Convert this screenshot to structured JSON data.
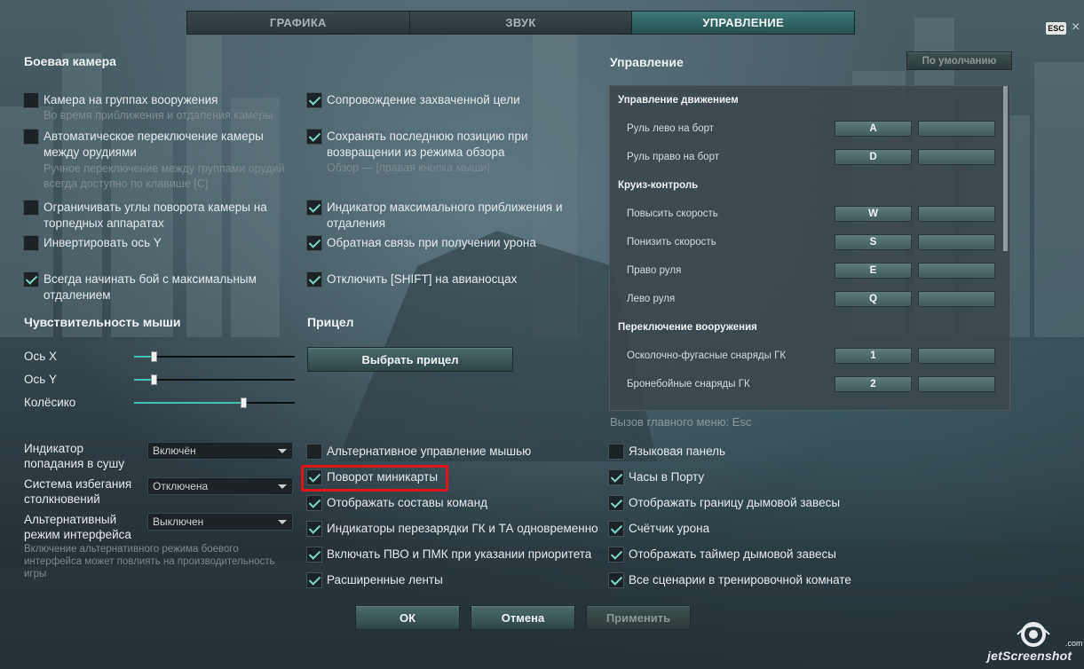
{
  "tabs": [
    {
      "label": "ГРАФИКА",
      "active": false
    },
    {
      "label": "ЗВУК",
      "active": false
    },
    {
      "label": "УПРАВЛЕНИЕ",
      "active": true
    }
  ],
  "esc_badge": "ESC",
  "close_glyph": "×",
  "camera": {
    "title": "Боевая камера",
    "left": [
      {
        "label": "Камера на группах вооружения",
        "sub": "Во время приближения и отдаления камеры",
        "checked": false
      },
      {
        "label": "Автоматическое переключение камеры между орудиями",
        "sub": "Ручное переключение между группами орудий всегда доступно по клавише [C]",
        "checked": false
      },
      {
        "label": "Ограничивать углы поворота камеры на торпедных аппаратах",
        "checked": false
      },
      {
        "label": "Инвертировать ось Y",
        "checked": false
      },
      {
        "label": "Всегда начинать бой с максимальным отдалением",
        "checked": true
      }
    ],
    "right": [
      {
        "label": "Сопровождение захваченной цели",
        "checked": true
      },
      {
        "label": "Сохранять последнюю позицию при возвращении из режима обзора",
        "sub": "Обзор — [правая кнопка мыши]",
        "checked": true
      },
      {
        "label": "Индикатор максимального приближения и отдаления",
        "checked": true
      },
      {
        "label": "Обратная связь при получении урона",
        "checked": true
      },
      {
        "label": "Отключить [SHIFT] на авианосцах",
        "checked": true
      }
    ]
  },
  "mouse": {
    "title": "Чувствительность мыши",
    "sliders": [
      {
        "label": "Ось X",
        "level": 0.12
      },
      {
        "label": "Ось Y",
        "level": 0.12
      },
      {
        "label": "Колёсико",
        "level": 0.68
      }
    ]
  },
  "sight": {
    "title": "Прицел",
    "button": "Выбрать прицел"
  },
  "dropdowns": [
    {
      "label": "Индикатор попадания в сушу",
      "value": "Включён"
    },
    {
      "label": "Система избегания столкновений",
      "value": "Отключена"
    },
    {
      "label": "Альтернативный режим интерфейса",
      "value": "Выключен"
    }
  ],
  "interface_note": "Включение альтернативного режима боевого интерфейса может повлиять на производительность игры",
  "middle_checks": [
    {
      "label": "Альтернативное управление мышью",
      "checked": false
    },
    {
      "label": "Поворот миникарты",
      "checked": true
    },
    {
      "label": "Отображать составы команд",
      "checked": true
    },
    {
      "label": "Индикаторы перезарядки ГК и ТА одновременно",
      "checked": true
    },
    {
      "label": "Включать ПВО и ПМК при указании приоритета",
      "checked": true
    },
    {
      "label": "Расширенные ленты",
      "checked": true
    }
  ],
  "right_checks": [
    {
      "label": "Языковая панель",
      "checked": false
    },
    {
      "label": "Часы в Порту",
      "checked": true
    },
    {
      "label": "Отображать границу дымовой завесы",
      "checked": true
    },
    {
      "label": "Счётчик урона",
      "checked": true
    },
    {
      "label": "Отображать таймер дымовой завесы",
      "checked": true
    },
    {
      "label": "Все сценарии в тренировочной комнате",
      "checked": true
    }
  ],
  "controls": {
    "title": "Управление",
    "defaults_button": "По умолчанию",
    "groups": [
      {
        "title": "Управление движением",
        "binds": [
          {
            "label": "Руль лево на борт",
            "key": "A",
            "alt": ""
          },
          {
            "label": "Руль право на борт",
            "key": "D",
            "alt": ""
          }
        ]
      },
      {
        "title": "Круиз-контроль",
        "binds": [
          {
            "label": "Повысить скорость",
            "key": "W",
            "alt": ""
          },
          {
            "label": "Понизить скорость",
            "key": "S",
            "alt": ""
          },
          {
            "label": "Право руля",
            "key": "E",
            "alt": ""
          },
          {
            "label": "Лево руля",
            "key": "Q",
            "alt": ""
          }
        ]
      },
      {
        "title": "Переключение вооружения",
        "binds": [
          {
            "label": "Осколочно-фугасные снаряды ГК",
            "key": "1",
            "alt": ""
          },
          {
            "label": "Бронебойные снаряды ГК",
            "key": "2",
            "alt": ""
          }
        ]
      }
    ],
    "menu_hint": "Вызов главного меню: Esc"
  },
  "footer": {
    "ok": "ОК",
    "cancel": "Отмена",
    "apply": "Применить"
  },
  "watermark": "jetScreenshot",
  "watermark_suffix": ".com",
  "colors": {
    "accent": "#40c7b3",
    "highlight": "#e1131a",
    "active_tab": "#2f6664"
  }
}
